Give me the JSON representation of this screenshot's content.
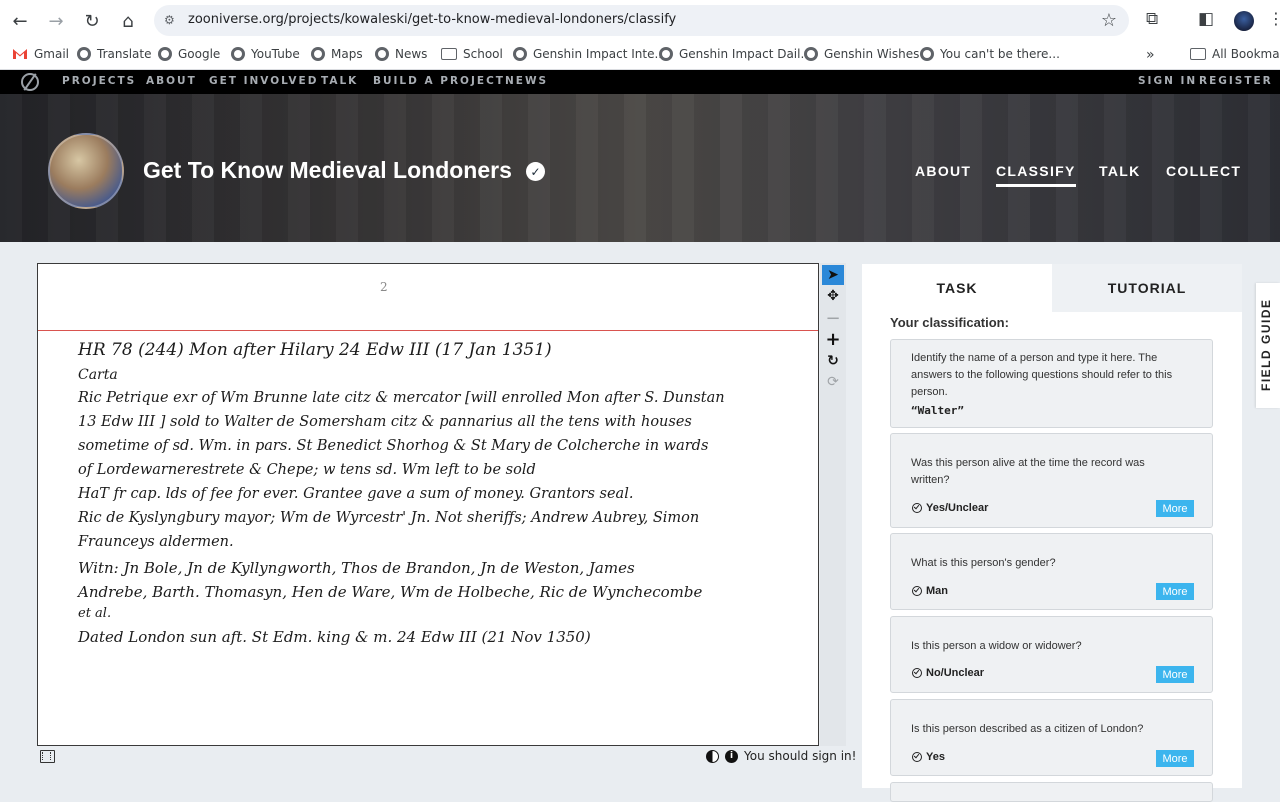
{
  "browser": {
    "url": "zooniverse.org/projects/kowaleski/get-to-know-medieval-londoners/classify",
    "bookmarks": [
      "Gmail",
      "Translate",
      "Google",
      "YouTube",
      "Maps",
      "News",
      "School",
      "Genshin Impact Inte...",
      "Genshin Impact Dail...",
      "Genshin Wishes",
      "You can't be there..."
    ],
    "all_bookmarks": "All Bookmarks",
    "overflow": "»"
  },
  "zoo_nav": {
    "links": [
      "PROJECTS",
      "ABOUT",
      "GET INVOLVED",
      "TALK",
      "BUILD A PROJECT",
      "NEWS"
    ],
    "sign_in": "SIGN IN",
    "register": "REGISTER"
  },
  "hero": {
    "title": "Get To Know Medieval Londoners",
    "verified": "✓",
    "links": [
      "ABOUT",
      "CLASSIFY",
      "TALK",
      "COLLECT"
    ],
    "active": "CLASSIFY"
  },
  "subject": {
    "page_number": "2",
    "lines": [
      "HR 78 (244)      Mon after Hilary 24 Edw III   (17 Jan 1351)",
      "Carta",
      "Ric Petrique  exr of Wm Brunne late citz & mercator [will enrolled Mon after S. Dunstan",
      "13 Edw III ] sold to Walter de Somersham citz & pannarius all the tens with houses",
      "sometime of sd. Wm. in pars. St Benedict Shorhog & St Mary de Colcherche in wards",
      "of Lordewarnerestrete & Chepe; w tens sd. Wm left to be sold",
      "HaT fr cap. lds of fee for ever.   Grantee gave a sum of money.   Grantors seal.",
      "Ric de Kyslyngbury mayor; Wm de Wyrcestr' Jn. Not sheriffs; Andrew Aubrey, Simon",
      "Fraunceys aldermen.",
      "Witn: Jn Bole, Jn de Kyllyngworth, Thos de Brandon, Jn de Weston, James",
      "Andrebe, Barth. Thomasyn, Hen de Ware, Wm de Holbeche, Ric de Wynchecombe",
      "et al.",
      "Dated London sun aft. St Edm. king & m. 24 Edw III    (21 Nov 1350)"
    ],
    "signin_note": "You should sign in!"
  },
  "task_panel": {
    "tabs": [
      "TASK",
      "TUTORIAL"
    ],
    "heading": "Your classification:",
    "cards": [
      {
        "question": "Identify the name of a person and type it here. The answers to the following questions should refer to this person.",
        "answer": "“Walter”"
      },
      {
        "question": "Was this person alive at the time the record was written?",
        "answer": "Yes/Unclear",
        "more": "More"
      },
      {
        "question": "What is this person's gender?",
        "answer": "Man",
        "more": "More"
      },
      {
        "question": "Is this person a widow or widower?",
        "answer": "No/Unclear",
        "more": "More"
      },
      {
        "question": "Is this person described as a citizen of London?",
        "answer": "Yes",
        "more": "More"
      }
    ]
  },
  "field_guide": "FIELD GUIDE",
  "colors": {
    "accent": "#3cb5ee",
    "tool_active": "#2b88d8",
    "nav_bg": "#000000",
    "page_bg": "#e9edf1"
  },
  "icons": [
    "back-arrow-icon",
    "forward-arrow-icon",
    "reload-icon",
    "home-icon",
    "site-settings-icon",
    "star-icon",
    "extensions-icon",
    "sidebar-icon",
    "pointer-icon",
    "move-icon",
    "zoom-out-icon",
    "zoom-in-icon",
    "rotate-icon",
    "reset-icon",
    "film-icon",
    "invert-icon",
    "info-icon",
    "check-circle-icon"
  ]
}
